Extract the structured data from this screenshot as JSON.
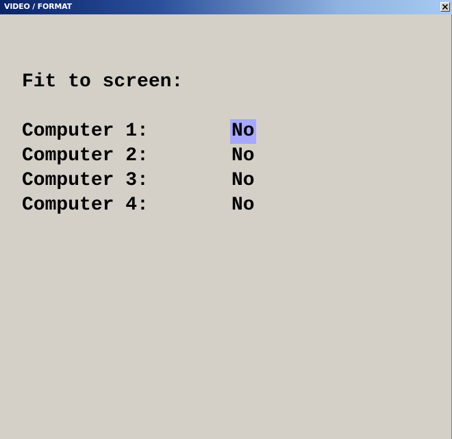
{
  "window": {
    "title": "VIDEO / FORMAT",
    "close_icon": "close-icon"
  },
  "main": {
    "heading": "Fit to screen:",
    "rows": [
      {
        "label": "Computer 1:",
        "value": "No",
        "selected": true
      },
      {
        "label": "Computer 2:",
        "value": "No",
        "selected": false
      },
      {
        "label": "Computer 3:",
        "value": "No",
        "selected": false
      },
      {
        "label": "Computer 4:",
        "value": "No",
        "selected": false
      }
    ]
  },
  "colors": {
    "background": "#d4d0c8",
    "titlebar_start": "#0a246a",
    "titlebar_end": "#a6caf0",
    "selection": "#a7a7ff"
  }
}
